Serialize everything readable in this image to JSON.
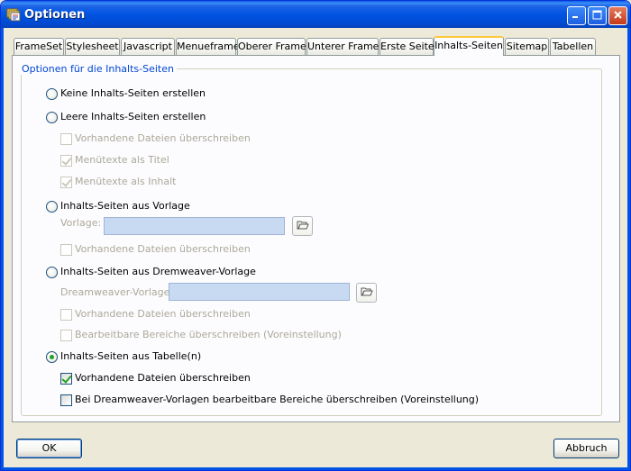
{
  "window": {
    "title": "Optionen"
  },
  "tabs": [
    {
      "label": "FrameSet"
    },
    {
      "label": "Stylesheet"
    },
    {
      "label": "Javascript"
    },
    {
      "label": "Menueframe"
    },
    {
      "label": "Oberer Frame"
    },
    {
      "label": "Unterer Frame"
    },
    {
      "label": "Erste Seite"
    },
    {
      "label": "Inhalts-Seiten",
      "active": true
    },
    {
      "label": "Sitemap"
    },
    {
      "label": "Tabellen"
    }
  ],
  "group": {
    "legend": "Optionen für die Inhalts-Seiten"
  },
  "options": {
    "none": {
      "label": "Keine Inhalts-Seiten erstellen",
      "selected": false
    },
    "empty": {
      "label": "Leere Inhalts-Seiten erstellen",
      "selected": false,
      "overwrite": {
        "label": "Vorhandene Dateien überschreiben",
        "checked": false,
        "enabled": false
      },
      "menu_as_title": {
        "label": "Menütexte als Titel",
        "checked": true,
        "enabled": false
      },
      "menu_as_content": {
        "label": "Menütexte als Inhalt",
        "checked": true,
        "enabled": false
      }
    },
    "template": {
      "label": "Inhalts-Seiten aus Vorlage",
      "selected": false,
      "field_label": "Vorlage:",
      "field_value": "",
      "overwrite": {
        "label": "Vorhandene Dateien überschreiben",
        "checked": false,
        "enabled": false
      }
    },
    "dreamweaver": {
      "label": "Inhalts-Seiten aus Dremweaver-Vorlage",
      "selected": false,
      "field_label": "Dreamweaver-Vorlage:",
      "field_value": "",
      "overwrite": {
        "label": "Vorhandene Dateien überschreiben",
        "checked": false,
        "enabled": false
      },
      "editable": {
        "label": "Bearbeitbare Bereiche überschreiben (Voreinstellung)",
        "checked": false,
        "enabled": false
      }
    },
    "table": {
      "label": "Inhalts-Seiten aus Tabelle(n)",
      "selected": true,
      "overwrite": {
        "label": "Vorhandene Dateien überschreiben",
        "checked": true,
        "enabled": true
      },
      "dw_editable": {
        "label": "Bei Dreamweaver-Vorlagen bearbeitbare Bereiche überschreiben (Voreinstellung)",
        "checked": false,
        "enabled": true
      }
    }
  },
  "buttons": {
    "ok": "OK",
    "cancel": "Abbruch"
  },
  "colors": {
    "titlebar": "#0054E3",
    "dialog_bg": "#ECE9D8",
    "panel_bg": "#FCFCFE",
    "legend_text": "#0046D5",
    "active_tab_accent": "#FFC83C",
    "check_mark": "#21A121",
    "disabled_text": "#ACA899",
    "input_bg": "#C8D9F2"
  },
  "icons": {
    "app": "folder-stack-icon",
    "minimize": "minimize-icon",
    "maximize": "maximize-icon",
    "close": "close-icon",
    "browse": "folder-open-icon"
  }
}
